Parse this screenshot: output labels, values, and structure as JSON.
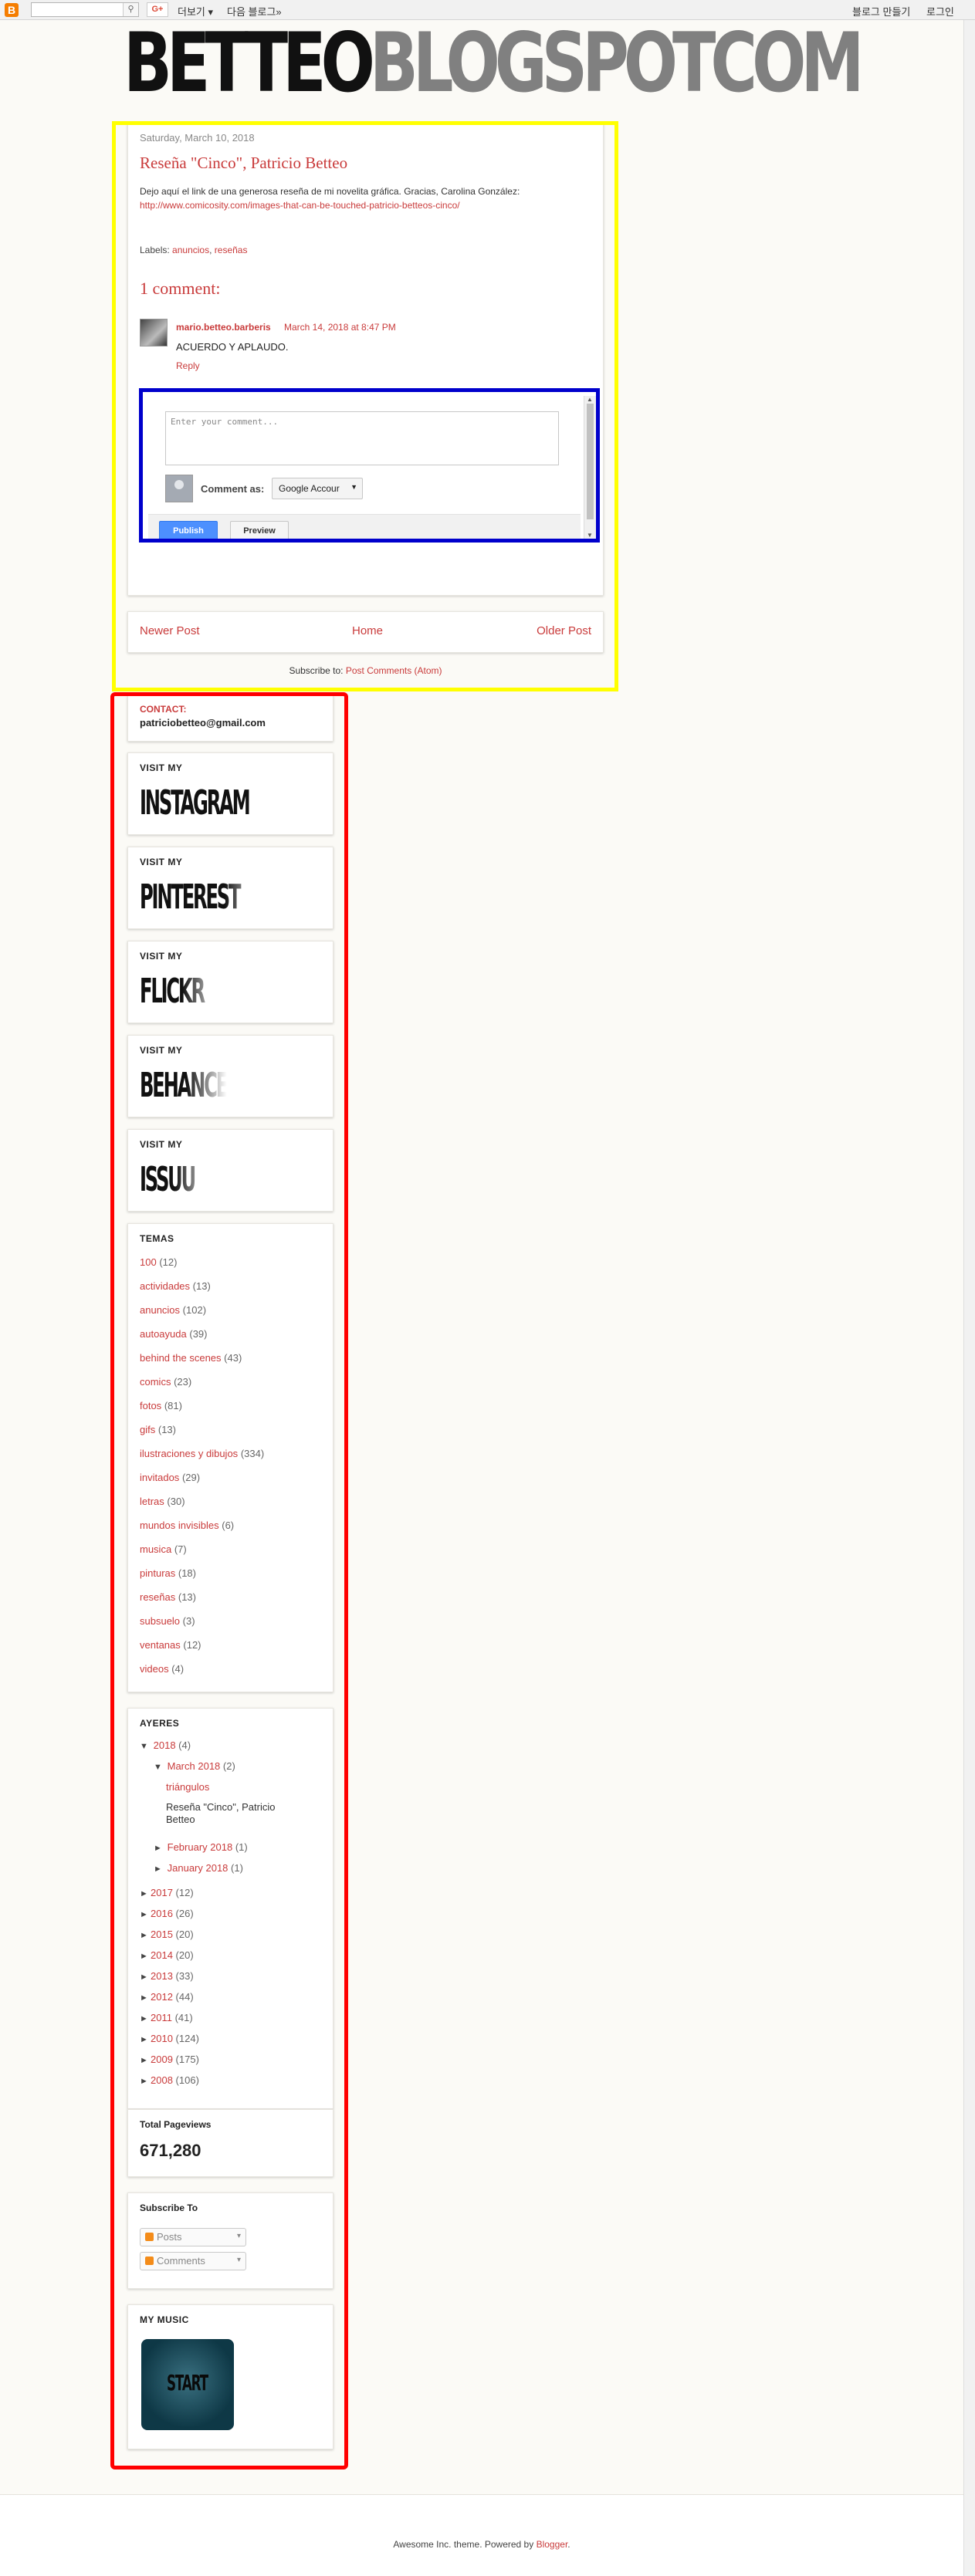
{
  "navbar": {
    "logo_glyph": "B",
    "search_icon": "⚲",
    "gplus": "G+",
    "more": "더보기 ▾",
    "next_blog": "다음 블로그»",
    "create_blog": "블로그 만들기",
    "login": "로그인"
  },
  "header": {
    "title_part1": "BETTEO",
    "title_part2": "BLOGSPOTCOM"
  },
  "post": {
    "date": "Saturday, March 10, 2018",
    "title": "Reseña \"Cinco\", Patricio Betteo",
    "body": "Dejo aquí el link de una generosa reseña de mi novelita gráfica. Gracias, Carolina González:",
    "link": "http://www.comicosity.com/images-that-can-be-touched-patricio-betteos-cinco/",
    "labels_prefix": "Labels:",
    "labels": [
      "anuncios",
      "reseñas"
    ],
    "comments_heading": "1 comment:",
    "comment": {
      "author": "mario.betteo.barberis",
      "date": "March 14, 2018 at 8:47 PM",
      "text": "ACUERDO Y APLAUDO.",
      "reply": "Reply"
    },
    "comment_form": {
      "placeholder": "Enter your comment...",
      "comment_as": "Comment as:",
      "identity": "Google Accour",
      "publish": "Publish",
      "preview": "Preview"
    }
  },
  "pager": {
    "newer": "Newer Post",
    "home": "Home",
    "older": "Older Post",
    "subscribe_prefix": "Subscribe to:",
    "subscribe_link": "Post Comments (Atom)"
  },
  "sidebar": {
    "contact": {
      "title": "CONTACT:",
      "email": "patriciobetteo@gmail.com"
    },
    "visit_title": "VISIT MY",
    "visits": [
      {
        "name": "INSTAGRAM"
      },
      {
        "name": "PINTEREST"
      },
      {
        "name": "FLICKR"
      },
      {
        "name": "BEHANCE"
      },
      {
        "name": "ISSUU"
      }
    ],
    "temas": {
      "title": "TEMAS",
      "items": [
        {
          "label": "100",
          "count": "(12)"
        },
        {
          "label": "actividades",
          "count": "(13)"
        },
        {
          "label": "anuncios",
          "count": "(102)"
        },
        {
          "label": "autoayuda",
          "count": "(39)"
        },
        {
          "label": "behind the scenes",
          "count": "(43)"
        },
        {
          "label": "comics",
          "count": "(23)"
        },
        {
          "label": "fotos",
          "count": "(81)"
        },
        {
          "label": "gifs",
          "count": "(13)"
        },
        {
          "label": "ilustraciones y dibujos",
          "count": "(334)"
        },
        {
          "label": "invitados",
          "count": "(29)"
        },
        {
          "label": "letras",
          "count": "(30)"
        },
        {
          "label": "mundos invisibles",
          "count": "(6)"
        },
        {
          "label": "musica",
          "count": "(7)"
        },
        {
          "label": "pinturas",
          "count": "(18)"
        },
        {
          "label": "reseñas",
          "count": "(13)"
        },
        {
          "label": "subsuelo",
          "count": "(3)"
        },
        {
          "label": "ventanas",
          "count": "(12)"
        },
        {
          "label": "videos",
          "count": "(4)"
        }
      ]
    },
    "ayeres": {
      "title": "AYERES",
      "open_year": {
        "label": "2018",
        "count": "(4)",
        "toggle": "▼"
      },
      "open_month": {
        "label": "March 2018",
        "count": "(2)",
        "toggle": "▼"
      },
      "posts": [
        "triángulos",
        "Reseña \"Cinco\", Patricio Betteo"
      ],
      "other_months": [
        {
          "label": "February 2018",
          "count": "(1)",
          "toggle": "►"
        },
        {
          "label": "January 2018",
          "count": "(1)",
          "toggle": "►"
        }
      ],
      "years": [
        {
          "label": "2017",
          "count": "(12)",
          "toggle": "►"
        },
        {
          "label": "2016",
          "count": "(26)",
          "toggle": "►"
        },
        {
          "label": "2015",
          "count": "(20)",
          "toggle": "►"
        },
        {
          "label": "2014",
          "count": "(20)",
          "toggle": "►"
        },
        {
          "label": "2013",
          "count": "(33)",
          "toggle": "►"
        },
        {
          "label": "2012",
          "count": "(44)",
          "toggle": "►"
        },
        {
          "label": "2011",
          "count": "(41)",
          "toggle": "►"
        },
        {
          "label": "2010",
          "count": "(124)",
          "toggle": "►"
        },
        {
          "label": "2009",
          "count": "(175)",
          "toggle": "►"
        },
        {
          "label": "2008",
          "count": "(106)",
          "toggle": "►"
        }
      ]
    },
    "pageviews": {
      "title": "Total Pageviews",
      "value": "671,280"
    },
    "subscribe": {
      "title": "Subscribe To",
      "posts": "Posts",
      "comments": "Comments"
    },
    "music": {
      "title": "MY MUSIC",
      "cover_text": "START"
    }
  },
  "footer": {
    "text": "Awesome Inc. theme. Powered by",
    "link": "Blogger",
    "suffix": "."
  },
  "colors": {
    "accent": "#c93b3b",
    "background": "#fbfaf6",
    "highlight_yellow": "#ffff00",
    "highlight_red": "#ff0000",
    "highlight_blue": "#0000cc"
  }
}
